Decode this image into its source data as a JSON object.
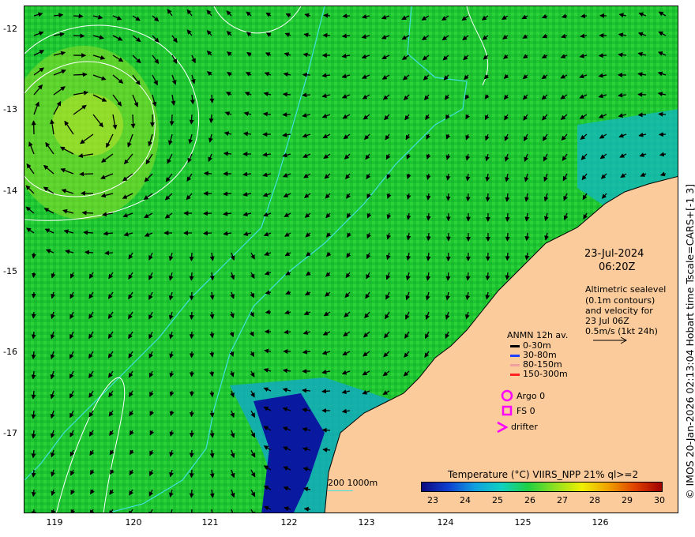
{
  "map": {
    "lat_ticks": [
      "-12",
      "-13",
      "-14",
      "-15",
      "-16",
      "-17"
    ],
    "lon_ticks": [
      "119",
      "120",
      "121",
      "122",
      "123",
      "124",
      "125",
      "126"
    ],
    "ocean_color": "#22cc33",
    "land_color": "#fbcb9b",
    "deep_blue": "#0a1aa0",
    "contour_color": "#40e0e0"
  },
  "annotation": {
    "date": "23-Jul-2024",
    "time": "06:20Z",
    "desc_lines": [
      "Altimetric sealevel",
      "(0.1m contours)",
      "and velocity for",
      "23 Jul 06Z",
      "0.5m/s (1kt 24h)"
    ]
  },
  "legend": {
    "title": "ANMN 12h av.",
    "rows": [
      {
        "label": "0-30m",
        "color": "#000000"
      },
      {
        "label": "30-80m",
        "color": "#2040ff"
      },
      {
        "label": "80-150m",
        "color": "#f0a0a0"
      },
      {
        "label": "150-300m",
        "color": "#ff2020"
      }
    ],
    "argo": "Argo 0",
    "fs": "FS 0",
    "drifter": "drifter",
    "marker_color": "#ff00ff"
  },
  "depth_legend": {
    "label": "200  1000m"
  },
  "colorbar": {
    "title": "Temperature (°C) VIIRS_NPP 21% ql>=2",
    "ticks": [
      "23",
      "24",
      "25",
      "26",
      "27",
      "28",
      "29",
      "30"
    ]
  },
  "credit": "© IMOS 20-Jan-2026 02:13:04 Hobart time Tscale=CARS+[-1 3]"
}
